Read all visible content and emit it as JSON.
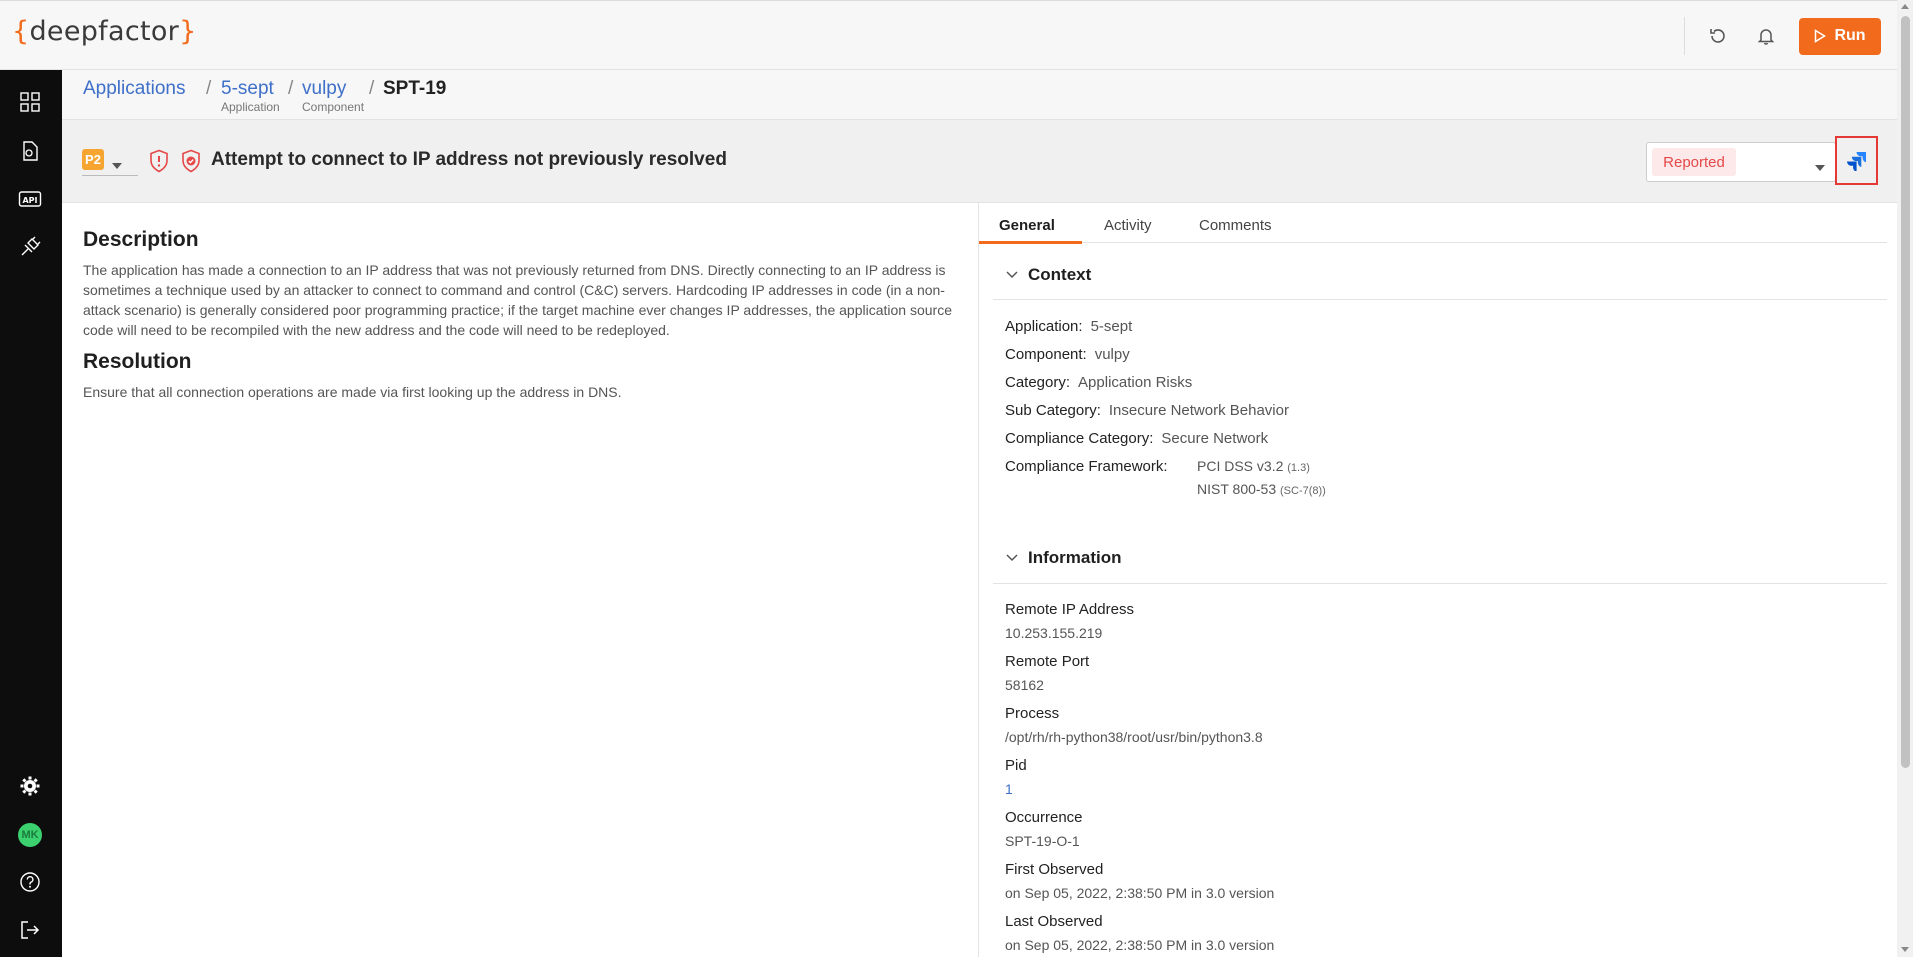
{
  "app": {
    "logo_open": "{",
    "logo_text": "deepfactor",
    "logo_close": "}"
  },
  "topbar": {
    "run_label": "Run"
  },
  "sidebar": {
    "avatar_initials": "MK"
  },
  "breadcrumb": {
    "applications": "Applications",
    "application": "5-sept",
    "application_sub": "Application",
    "component": "vulpy",
    "component_sub": "Component",
    "current": "SPT-19",
    "separator": "/"
  },
  "alert": {
    "priority": "P2",
    "title": "Attempt to connect to IP address not previously resolved",
    "status": "Reported"
  },
  "description": {
    "heading": "Description",
    "text": "The application has made a connection to an IP address that was not previously returned from DNS. Directly connecting to an IP address is sometimes a technique used by an attacker to connect to command and control (C&C) servers. Hardcoding IP addresses in code (in a non-attack scenario) is generally considered poor programming practice; if the target machine ever changes IP addresses, the application source code will need to be recompiled with the new address and the code will need to be redeployed."
  },
  "resolution": {
    "heading": "Resolution",
    "text": "Ensure that all connection operations are made via first looking up the address in DNS."
  },
  "tabs": [
    "General",
    "Activity",
    "Comments"
  ],
  "context": {
    "heading": "Context",
    "application_k": "Application:",
    "application_v": "5-sept",
    "component_k": "Component:",
    "component_v": "vulpy",
    "category_k": "Category:",
    "category_v": "Application Risks",
    "subcategory_k": "Sub Category:",
    "subcategory_v": "Insecure Network Behavior",
    "compliance_category_k": "Compliance Category:",
    "compliance_category_v": "Secure Network",
    "framework_k": "Compliance Framework:",
    "framework_1": "PCI DSS v3.2",
    "framework_1_sub": "(1.3)",
    "framework_2": "NIST 800-53",
    "framework_2_sub": "(SC-7(8))"
  },
  "information": {
    "heading": "Information",
    "remote_ip_k": "Remote IP Address",
    "remote_ip_v": "10.253.155.219",
    "remote_port_k": "Remote Port",
    "remote_port_v": "58162",
    "process_k": "Process",
    "process_v": "/opt/rh/rh-python38/root/usr/bin/python3.8",
    "pid_k": "Pid",
    "pid_v": "1",
    "occurrence_k": "Occurrence",
    "occurrence_v": "SPT-19-O-1",
    "first_observed_k": "First Observed",
    "first_observed_v": "on Sep 05, 2022, 2:38:50 PM in 3.0 version",
    "last_observed_k": "Last Observed",
    "last_observed_v": "on Sep 05, 2022, 2:38:50 PM in 3.0 version"
  },
  "colors": {
    "accent": "#f26b1d",
    "link": "#3e6fc9",
    "status_red": "#e54848",
    "priority": "#f7a531"
  }
}
